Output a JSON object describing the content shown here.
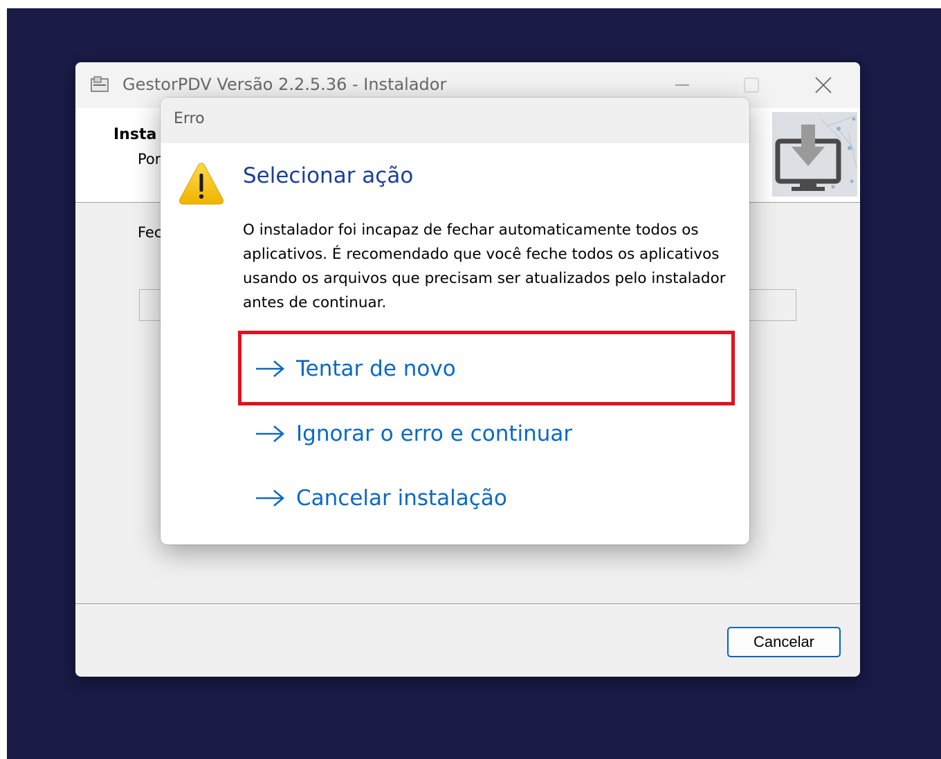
{
  "installer": {
    "title": "GestorPDV Versão 2.2.5.36 - Instalador",
    "header_title": "Insta",
    "header_subtitle": "Por",
    "body_label": "Fec",
    "cancel_label": "Cancelar"
  },
  "icons": {
    "app": "installer-app-icon",
    "minimize": "minimize-icon",
    "maximize": "maximize-icon",
    "close": "close-icon",
    "header_image": "monitor-download-icon",
    "warning": "warning-icon",
    "arrow": "arrow-right-icon"
  },
  "dialog": {
    "title": "Erro",
    "heading": "Selecionar ação",
    "message": "O instalador foi incapaz de fechar automaticamente todos os aplicativos. É recomendado que você feche todos os aplicativos usando os arquivos que precisam ser atualizados pelo instalador antes de continuar.",
    "options": [
      {
        "label": "Tentar de novo"
      },
      {
        "label": "Ignorar o erro e continuar"
      },
      {
        "label": "Cancelar instalação"
      }
    ]
  },
  "colors": {
    "desktop": "#1a1b47",
    "heading": "#1a3e9c",
    "link": "#0a69c4",
    "highlight": "#e0121e",
    "warning_fill": "#f5c518"
  }
}
